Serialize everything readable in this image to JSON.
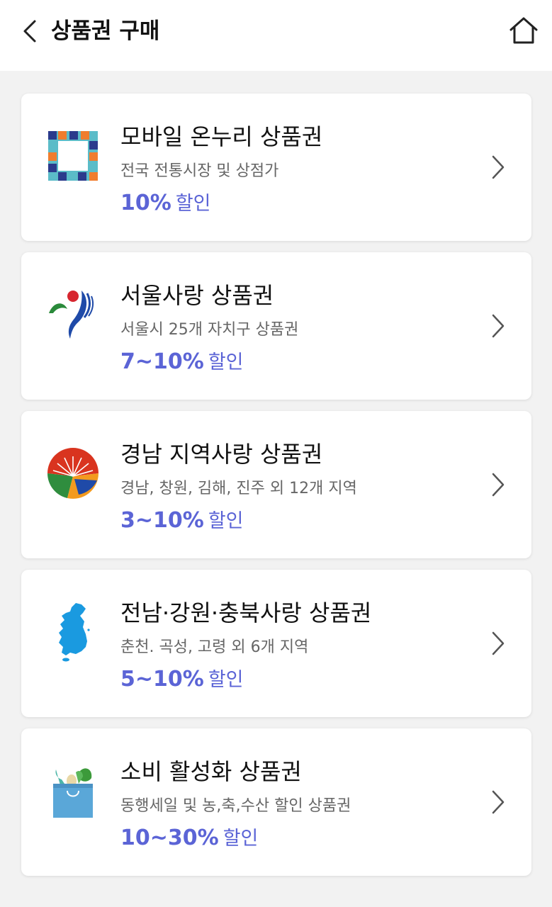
{
  "header": {
    "title": "상품권 구매",
    "back_icon": "chevron-left-icon",
    "home_icon": "home-icon"
  },
  "accent_color": "#5b64d6",
  "vouchers": [
    {
      "title": "모바일 온누리 상품권",
      "subtitle": "전국 전통시장 및 상점가",
      "discount": "10%",
      "discount_label": "할인",
      "logo": "onnuri-logo-icon"
    },
    {
      "title": "서울사랑 상품권",
      "subtitle": "서울시 25개 자치구 상품권",
      "discount": "7~10%",
      "discount_label": "할인",
      "logo": "seoul-logo-icon"
    },
    {
      "title": "경남 지역사랑 상품권",
      "subtitle": "경남, 창원, 김해, 진주 외 12개 지역",
      "discount": "3~10%",
      "discount_label": "할인",
      "logo": "gyeongnam-logo-icon"
    },
    {
      "title": "전남·강원·충북사랑 상품권",
      "subtitle": "춘천. 곡성, 고령 외 6개 지역",
      "discount": "5~10%",
      "discount_label": "할인",
      "logo": "korea-map-icon"
    },
    {
      "title": "소비 활성화 상품권",
      "subtitle": "동행세일 및 농,축,수산 할인 상품권",
      "discount": "10~30%",
      "discount_label": "할인",
      "logo": "grocery-bag-icon"
    }
  ]
}
